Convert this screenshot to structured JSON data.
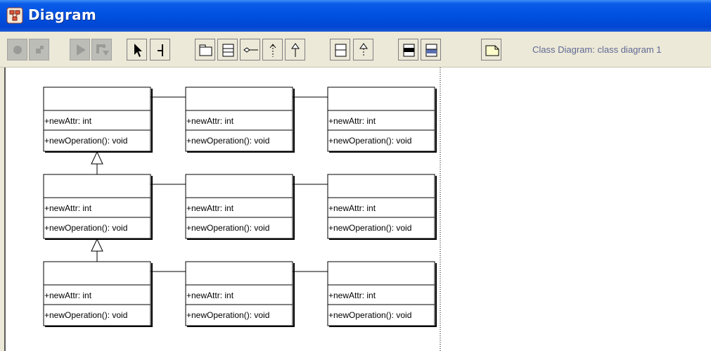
{
  "window": {
    "title": "Diagram",
    "accent": "#0a5ce8"
  },
  "toolbar": {
    "buttons": [
      {
        "name": "record-button",
        "icon": "record-icon",
        "enabled": false
      },
      {
        "name": "grid-button",
        "icon": "grid-icon",
        "enabled": false
      },
      {
        "name": "play-button",
        "icon": "play-icon",
        "enabled": false
      },
      {
        "name": "edit-button",
        "icon": "edit-icon",
        "enabled": false
      },
      {
        "name": "select-tool-button",
        "icon": "arrow-pointer-icon",
        "enabled": true
      },
      {
        "name": "broom-tool-button",
        "icon": "broom-icon",
        "enabled": true
      },
      {
        "name": "package-tool-button",
        "icon": "package-icon",
        "enabled": true
      },
      {
        "name": "class-tool-button",
        "icon": "class-icon",
        "enabled": true
      },
      {
        "name": "association-tool-button",
        "icon": "association-icon",
        "enabled": true
      },
      {
        "name": "dependency-tool-button",
        "icon": "dependency-icon",
        "enabled": true
      },
      {
        "name": "generalization-tool-button",
        "icon": "generalization-icon",
        "enabled": true
      },
      {
        "name": "interface-tool-button",
        "icon": "interface-icon",
        "enabled": true
      },
      {
        "name": "realization-tool-button",
        "icon": "realization-icon",
        "enabled": true
      },
      {
        "name": "add-attribute-button",
        "icon": "add-attribute-icon",
        "enabled": true
      },
      {
        "name": "add-operation-button",
        "icon": "add-operation-icon",
        "enabled": true
      },
      {
        "name": "note-tool-button",
        "icon": "note-icon",
        "enabled": true
      }
    ],
    "status_text": "Class Diagram: class diagram 1"
  },
  "diagram": {
    "classes": [
      {
        "id": "r1c1",
        "name": "",
        "attribute": "+newAttr: int",
        "operation": "+newOperation(): void"
      },
      {
        "id": "r1c2",
        "name": "",
        "attribute": "+newAttr: int",
        "operation": "+newOperation(): void"
      },
      {
        "id": "r1c3",
        "name": "",
        "attribute": "+newAttr: int",
        "operation": "+newOperation(): void"
      },
      {
        "id": "r2c1",
        "name": "",
        "attribute": "+newAttr: int",
        "operation": "+newOperation(): void"
      },
      {
        "id": "r2c2",
        "name": "",
        "attribute": "+newAttr: int",
        "operation": "+newOperation(): void"
      },
      {
        "id": "r2c3",
        "name": "",
        "attribute": "+newAttr: int",
        "operation": "+newOperation(): void"
      },
      {
        "id": "r3c1",
        "name": "",
        "attribute": "+newAttr: int",
        "operation": "+newOperation(): void"
      },
      {
        "id": "r3c2",
        "name": "",
        "attribute": "+newAttr: int",
        "operation": "+newOperation(): void"
      },
      {
        "id": "r3c3",
        "name": "",
        "attribute": "+newAttr: int",
        "operation": "+newOperation(): void"
      }
    ],
    "associations": [
      {
        "from": "r1c1",
        "to": "r1c2"
      },
      {
        "from": "r1c2",
        "to": "r1c3"
      },
      {
        "from": "r2c1",
        "to": "r2c2"
      },
      {
        "from": "r2c2",
        "to": "r2c3"
      },
      {
        "from": "r3c1",
        "to": "r3c2"
      },
      {
        "from": "r3c2",
        "to": "r3c3"
      }
    ],
    "generalizations": [
      {
        "from": "r2c1",
        "to": "r1c1"
      },
      {
        "from": "r3c1",
        "to": "r2c1"
      }
    ]
  }
}
